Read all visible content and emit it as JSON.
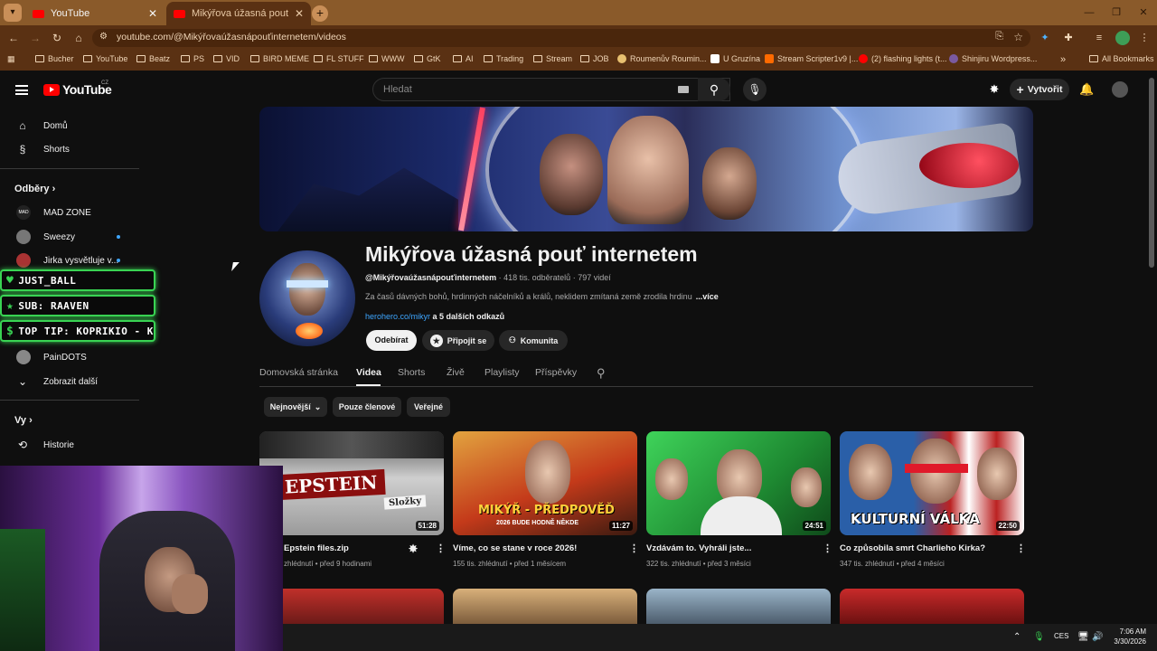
{
  "browser": {
    "tabs": [
      {
        "title": "YouTube"
      },
      {
        "title": "Mikýřova úžasná pouť internetem"
      }
    ],
    "url": "youtube.com/@Mikýřovaúžasnápouťinternetem/videos",
    "bookmarks": [
      "Bucher",
      "YouTube",
      "Beatz",
      "PS",
      "VID",
      "BIRD MEME",
      "FL STUFF",
      "WWW",
      "GtK",
      "AI",
      "Trading",
      "Stream",
      "JOB",
      "Roumenův Roumin...",
      "U Gruzína",
      "Stream Scripter1v9 |...",
      "(2) flashing lights (t...",
      "Shinjiru Wordpress..."
    ],
    "all_bookmarks": "All Bookmarks",
    "more": "»"
  },
  "header": {
    "logo_text": "YouTube",
    "country": "CZ",
    "search_placeholder": "Hledat",
    "create_label": "Vytvořit"
  },
  "sidebar": {
    "home": "Domů",
    "shorts": "Shorts",
    "subs_heading": "Odběry",
    "subscriptions": [
      "MAD ZONE",
      "Sweezy",
      "Jirka vysvětluje v..."
    ],
    "overlays": [
      "JUST_BALL",
      "SUB: RAAVEN",
      "TOP TIP: KOPRIKIO - K"
    ],
    "more_subs": [
      "PainDOTS"
    ],
    "show_more": "Zobrazit další",
    "you_heading": "Vy",
    "history": "Historie"
  },
  "channel": {
    "name": "Mikýřova úžasná pouť internetem",
    "handle": "@Mikýřovaúžasnápouťinternetem",
    "subscribers": "418 tis. odběratelů",
    "videos": "797 videí",
    "description": "Za časů dávných bohů, hrdinných náčelníků a králů, neklidem zmítaná země zrodila hrdinu",
    "more": "...více",
    "link": "herohero.co/mikyr",
    "links_more": "a 5 dalších odkazů",
    "subscribe": "Odebírat",
    "join": "Připojit se",
    "community": "Komunita"
  },
  "channel_tabs": [
    "Domovská stránka",
    "Videa",
    "Shorts",
    "Živě",
    "Playlisty",
    "Příspěvky"
  ],
  "chips": [
    "Nejnovější",
    "Pouze členové",
    "Veřejné"
  ],
  "videos": [
    {
      "title": "Epstein files.zip",
      "meta": "zhlédnutí • před 9 hodinami",
      "duration": "51:28",
      "thumb_text": "EPSTEIN",
      "thumb_sub": "Složky"
    },
    {
      "title": "Víme, co se stane v roce 2026!",
      "meta": "155 tis. zhlédnutí • před 1 měsícem",
      "duration": "11:27",
      "thumb_text": "MIKÝŘ - PŘEDPOVĚĎ",
      "thumb_sub": "2026 BUDE HODNĚ NĚKDE"
    },
    {
      "title": "Vzdávám to. Vyhráli jste...",
      "meta": "322 tis. zhlédnutí • před 3 měsíci",
      "duration": "24:51"
    },
    {
      "title": "Co způsobila smrt Charlieho Kirka?",
      "meta": "347 tis. zhlédnutí • před 4 měsíci",
      "duration": "22:50",
      "thumb_text": "KULTURNÍ VÁLKA"
    }
  ],
  "taskbar": {
    "lang": "CES",
    "time": "7:06 AM",
    "date": "3/30/2026"
  }
}
